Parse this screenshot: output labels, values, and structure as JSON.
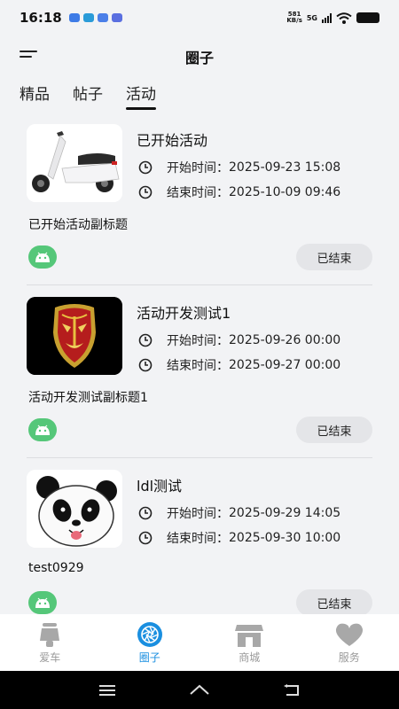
{
  "status_bar": {
    "time": "16:18",
    "net_speed_value": "581",
    "net_speed_unit": "KB/s",
    "network": "5G"
  },
  "header": {
    "title": "圈子"
  },
  "tabs": [
    {
      "label": "精品",
      "active": false
    },
    {
      "label": "帖子",
      "active": false
    },
    {
      "label": "活动",
      "active": true
    }
  ],
  "activities": [
    {
      "title": "已开始活动",
      "start_label": "开始时间：",
      "start_time": "2025-09-23 15:08",
      "end_label": "结束时间：",
      "end_time": "2025-10-09 09:46",
      "subtitle": "已开始活动副标题",
      "status": "已结束",
      "thumb": "scooter-image"
    },
    {
      "title": "活动开发测试1",
      "start_label": "开始时间：",
      "start_time": "2025-09-26 00:00",
      "end_label": "结束时间：",
      "end_time": "2025-09-27 00:00",
      "subtitle": "活动开发测试副标题1",
      "status": "已结束",
      "thumb": "mask-image"
    },
    {
      "title": "ldl测试",
      "start_label": "开始时间：",
      "start_time": "2025-09-29 14:05",
      "end_label": "结束时间：",
      "end_time": "2025-09-30 10:00",
      "subtitle": "test0929",
      "status": "已结束",
      "thumb": "panda-image"
    }
  ],
  "bottom_nav": [
    {
      "label": "爱车",
      "icon": "scooter-icon",
      "active": false
    },
    {
      "label": "圈子",
      "icon": "aperture-icon",
      "active": true
    },
    {
      "label": "商城",
      "icon": "store-icon",
      "active": false
    },
    {
      "label": "服务",
      "icon": "heart-icon",
      "active": false
    }
  ],
  "colors": {
    "accent": "#1a8fe0",
    "android_green": "#55c779",
    "pill_bg": "#e4e5e8",
    "background": "#f2f3f5"
  }
}
